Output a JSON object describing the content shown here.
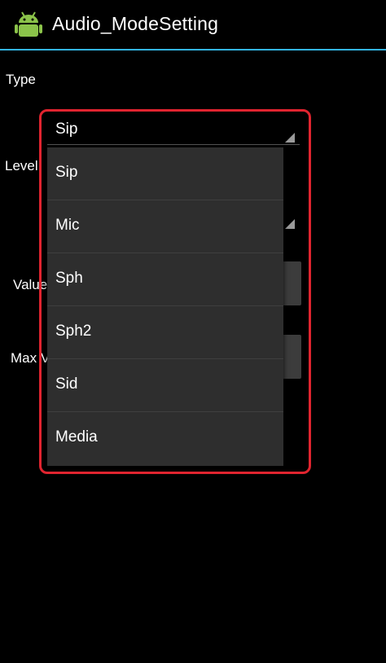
{
  "action_bar": {
    "title": "Audio_ModeSetting",
    "icon": "android-robot-icon",
    "accent_color": "#33b5e5"
  },
  "form": {
    "type_label": "Type",
    "level_label": "Level",
    "value_label": "Value",
    "max_label": "Max V"
  },
  "spinner": {
    "selected": "Sip",
    "options": [
      "Sip",
      "Mic",
      "Sph",
      "Sph2",
      "Sid",
      "Media"
    ]
  },
  "highlight_color": "#e0242f"
}
